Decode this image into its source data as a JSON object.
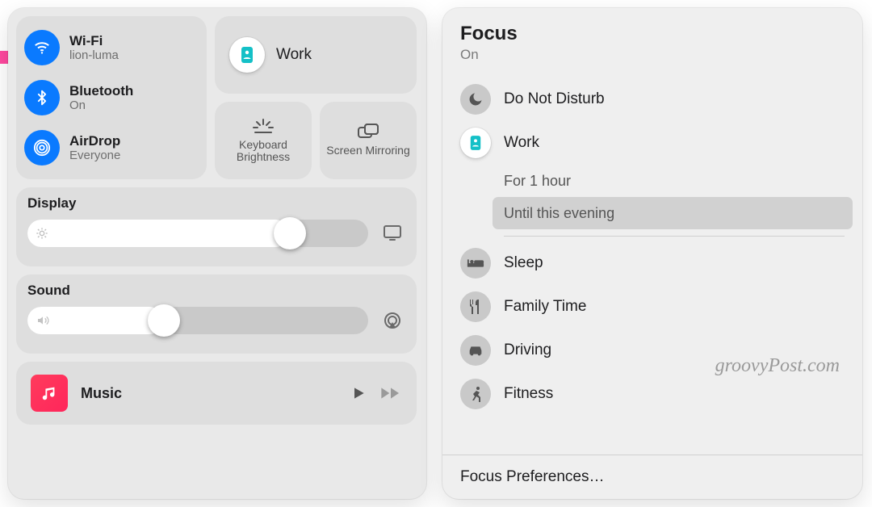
{
  "control_center": {
    "connectivity": {
      "wifi": {
        "label": "Wi-Fi",
        "status": "lion-luma"
      },
      "bluetooth": {
        "label": "Bluetooth",
        "status": "On"
      },
      "airdrop": {
        "label": "AirDrop",
        "status": "Everyone"
      }
    },
    "focus_tile": {
      "label": "Work"
    },
    "keyboard_brightness": "Keyboard Brightness",
    "screen_mirroring": "Screen Mirroring",
    "display": {
      "title": "Display",
      "value_pct": 77
    },
    "sound": {
      "title": "Sound",
      "value_pct": 40
    },
    "music": {
      "title": "Music"
    }
  },
  "focus_sheet": {
    "title": "Focus",
    "state": "On",
    "modes": [
      {
        "id": "dnd",
        "label": "Do Not Disturb",
        "icon": "moon",
        "active": false
      },
      {
        "id": "work",
        "label": "Work",
        "icon": "badge",
        "active": true,
        "sub": [
          {
            "label": "For 1 hour",
            "selected": false
          },
          {
            "label": "Until this evening",
            "selected": true
          }
        ]
      },
      {
        "id": "sleep",
        "label": "Sleep",
        "icon": "bed",
        "active": false
      },
      {
        "id": "family",
        "label": "Family Time",
        "icon": "fork",
        "active": false
      },
      {
        "id": "driving",
        "label": "Driving",
        "icon": "car",
        "active": false
      },
      {
        "id": "fitness",
        "label": "Fitness",
        "icon": "runner",
        "active": false
      }
    ],
    "preferences": "Focus Preferences…"
  },
  "watermark": "groovyPost.com",
  "colors": {
    "accent": "#0a7aff",
    "panel": "#e9e9e9",
    "tile": "#dedede"
  }
}
